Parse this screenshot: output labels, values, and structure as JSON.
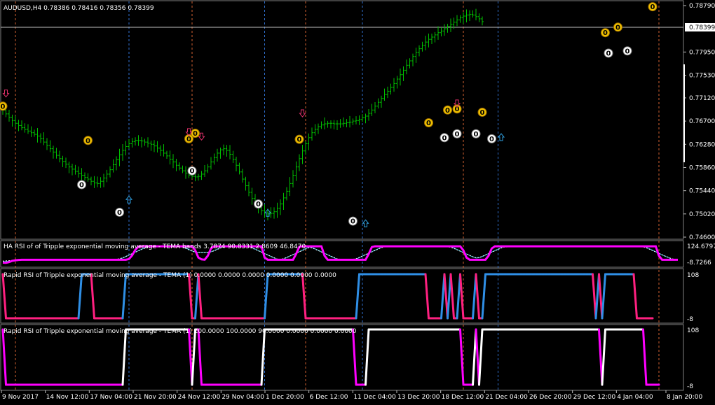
{
  "header": {
    "symbol_info": "AUDUSD,H4  0.78386 0.78416 0.78356 0.78399"
  },
  "colors": {
    "background": "#000000",
    "candles": "#00c000",
    "grid": "#808080",
    "price_line": "#c0c0c0",
    "vline_red": "#d06030",
    "vline_blue": "#3070d0",
    "pink": "#ff2080",
    "magenta": "#ff00ff",
    "blue": "#2f8fe6",
    "white": "#ffffff",
    "cyan": "#33c0e0",
    "yellow_marker": "#f0c000",
    "arrow_down": "#e0306a",
    "arrow_up": "#30a0e0"
  },
  "price_axis": {
    "labels": [
      "0.78790",
      "0.78399",
      "0.77950",
      "0.77530",
      "0.77120",
      "0.76700",
      "0.76280",
      "0.75860",
      "0.75440",
      "0.75020",
      "0.74600"
    ],
    "current": "0.78399"
  },
  "time_axis": {
    "labels": [
      "9 Nov 2017",
      "14 Nov 12:00",
      "17 Nov 04:00",
      "21 Nov 20:00",
      "24 Nov 12:00",
      "29 Nov 04:00",
      "1 Dec 20:00",
      "6 Dec 12:00",
      "11 Dec 04:00",
      "13 Dec 20:00",
      "18 Dec 12:00",
      "21 Dec 04:00",
      "26 Dec 20:00",
      "29 Dec 12:00",
      "4 Jan 04:00",
      "8 Jan 20:00"
    ]
  },
  "main_chart": {
    "marker_label": "0",
    "close_prices": [
      0.769,
      0.7683,
      0.7677,
      0.7671,
      0.7666,
      0.7662,
      0.7658,
      0.7655,
      0.7652,
      0.7649,
      0.7646,
      0.7643,
      0.7638,
      0.7632,
      0.7626,
      0.762,
      0.7614,
      0.7608,
      0.7602,
      0.7597,
      0.7592,
      0.7587,
      0.7583,
      0.7579,
      0.7575,
      0.7572,
      0.7568,
      0.7565,
      0.7561,
      0.7558,
      0.7557,
      0.7561,
      0.7567,
      0.7574,
      0.7582,
      0.7591,
      0.76,
      0.7609,
      0.7617,
      0.7624,
      0.7629,
      0.7633,
      0.7635,
      0.7635,
      0.7634,
      0.7632,
      0.763,
      0.7628,
      0.7625,
      0.7621,
      0.7617,
      0.7612,
      0.7607,
      0.7601,
      0.7596,
      0.759,
      0.7585,
      0.758,
      0.7576,
      0.7572,
      0.757,
      0.7569,
      0.757,
      0.7574,
      0.758,
      0.7587,
      0.7596,
      0.7604,
      0.7612,
      0.7618,
      0.762,
      0.7617,
      0.761,
      0.7601,
      0.759,
      0.7578,
      0.7565,
      0.7553,
      0.7541,
      0.753,
      0.7521,
      0.7514,
      0.7508,
      0.7504,
      0.7502,
      0.7503,
      0.7506,
      0.7512,
      0.752,
      0.7531,
      0.7543,
      0.7557,
      0.7572,
      0.7587,
      0.7602,
      0.7616,
      0.7629,
      0.764,
      0.7649,
      0.7655,
      0.766,
      0.7663,
      0.7665,
      0.7666,
      0.7666,
      0.7665,
      0.7665,
      0.7665,
      0.7666,
      0.7667,
      0.7668,
      0.767,
      0.7671,
      0.7673,
      0.7676,
      0.7679,
      0.7684,
      0.769,
      0.7697,
      0.7704,
      0.7711,
      0.7718,
      0.7724,
      0.7731,
      0.7738,
      0.7746,
      0.7754,
      0.7762,
      0.7771,
      0.7779,
      0.7787,
      0.7794,
      0.7801,
      0.7807,
      0.7813,
      0.7818,
      0.7822,
      0.7826,
      0.783,
      0.7833,
      0.7837,
      0.7841,
      0.7845,
      0.7849,
      0.7853,
      0.7857,
      0.786,
      0.7862,
      0.7863,
      0.7862,
      0.7859,
      0.7855,
      0.785
    ],
    "yellow_markers": [
      [
        0,
        0.7697
      ],
      [
        27,
        0.7635
      ],
      [
        59,
        0.7638
      ],
      [
        61,
        0.7648
      ],
      [
        94,
        0.7637
      ],
      [
        135,
        0.7667
      ],
      [
        141,
        0.769
      ],
      [
        144,
        0.7692
      ],
      [
        152,
        0.7686
      ],
      [
        191,
        0.783
      ],
      [
        195,
        0.784
      ],
      [
        206,
        0.7877
      ]
    ],
    "white_markers": [
      [
        25,
        0.7555
      ],
      [
        37,
        0.7505
      ],
      [
        60,
        0.758
      ],
      [
        81,
        0.752
      ],
      [
        111,
        0.7489
      ],
      [
        140,
        0.764
      ],
      [
        144,
        0.7647
      ],
      [
        150,
        0.7647
      ],
      [
        155,
        0.7638
      ],
      [
        192,
        0.7793
      ],
      [
        198,
        0.7797
      ]
    ],
    "down_arrows": [
      [
        1,
        0.772
      ],
      [
        59,
        0.765
      ],
      [
        63,
        0.7642
      ],
      [
        95,
        0.7684
      ],
      [
        144,
        0.7702
      ]
    ],
    "up_arrows": [
      [
        40,
        0.7528
      ],
      [
        84,
        0.7504
      ],
      [
        115,
        0.7485
      ],
      [
        158,
        0.7641
      ]
    ]
  },
  "panel1": {
    "title": "HA RSI of of Tripple exponential moving average - TEMA bands 3.7874 90.8331 2.8609 46.8470",
    "max_label": "124.6797",
    "min_label": "-8.7266"
  },
  "panel2": {
    "title": "Rapid RSI of Tripple exponential moving average - TEMA (1) 0.0000 0.0000 0.0000 0.0000 0.0000 0.0000",
    "max_label": "108",
    "min_label": "-8"
  },
  "panel3": {
    "title": "Rapid RSI of Tripple exponential moving average - TEMA (1) 100.0000 100.0000 90.0000 0.0000 0.0000 0.0000",
    "max_label": "108",
    "min_label": "-8"
  },
  "vlines": [
    {
      "x_idx": 4,
      "color": "red"
    },
    {
      "x_idx": 40,
      "color": "blue"
    },
    {
      "x_idx": 60,
      "color": "red"
    },
    {
      "x_idx": 83,
      "color": "blue"
    },
    {
      "x_idx": 96,
      "color": "red"
    },
    {
      "x_idx": 114,
      "color": "blue"
    },
    {
      "x_idx": 146,
      "color": "red"
    },
    {
      "x_idx": 157,
      "color": "blue"
    },
    {
      "x_idx": 208,
      "color": "red"
    }
  ],
  "panel1_series": [
    2,
    1,
    5,
    12,
    15,
    17,
    18,
    18,
    18,
    18,
    18,
    18,
    18,
    18,
    18,
    18,
    18,
    18,
    18,
    18,
    18,
    18,
    18,
    18,
    18,
    18,
    18,
    18,
    18,
    18,
    18,
    18,
    18,
    18,
    18,
    18,
    18,
    18,
    18,
    18,
    22,
    42,
    72,
    90,
    92,
    92,
    92,
    92,
    92,
    92,
    92,
    92,
    92,
    92,
    92,
    92,
    92,
    92,
    92,
    92,
    91,
    70,
    30,
    20,
    18,
    40,
    80,
    92,
    92,
    92,
    92,
    92,
    92,
    92,
    92,
    92,
    92,
    92,
    92,
    92,
    92,
    92,
    92,
    30,
    18,
    18,
    18,
    18,
    18,
    18,
    18,
    18,
    18,
    50,
    90,
    92,
    92,
    92,
    92,
    92,
    92,
    92,
    40,
    18,
    18,
    18,
    18,
    18,
    18,
    18,
    18,
    18,
    18,
    18,
    18,
    18,
    50,
    88,
    92,
    92,
    92,
    92,
    92,
    92,
    92,
    92,
    92,
    92,
    92,
    92,
    92,
    92,
    92,
    92,
    92,
    92,
    92,
    92,
    92,
    92,
    92,
    92,
    92,
    92,
    92,
    92,
    70,
    30,
    18,
    18,
    18,
    18,
    18,
    18,
    40,
    80,
    92,
    92,
    92,
    92,
    92,
    92,
    92,
    92,
    92,
    92,
    92,
    92,
    92,
    92,
    92,
    92,
    92,
    92,
    92,
    92,
    92,
    92,
    92,
    92,
    92,
    92,
    92,
    92,
    92,
    92,
    92,
    92,
    92,
    92,
    92,
    92,
    92,
    92,
    92,
    92,
    92,
    92,
    92,
    92,
    92,
    92,
    92,
    92,
    92,
    92,
    92,
    92,
    40,
    18,
    18,
    18,
    18,
    18,
    18
  ],
  "panel2_series": [
    100,
    0,
    0,
    0,
    0,
    0,
    0,
    0,
    0,
    0,
    0,
    0,
    0,
    0,
    0,
    0,
    0,
    0,
    0,
    0,
    0,
    0,
    0,
    0,
    0,
    100,
    100,
    100,
    100,
    0,
    0,
    0,
    0,
    0,
    0,
    0,
    0,
    0,
    0,
    100,
    100,
    100,
    100,
    100,
    100,
    100,
    100,
    100,
    100,
    100,
    100,
    100,
    100,
    100,
    100,
    100,
    100,
    100,
    100,
    100,
    0,
    0,
    100,
    0,
    0,
    0,
    0,
    0,
    0,
    0,
    0,
    0,
    0,
    0,
    0,
    0,
    0,
    0,
    0,
    0,
    0,
    0,
    0,
    0,
    100,
    100,
    100,
    100,
    100,
    100,
    100,
    100,
    100,
    100,
    100,
    100,
    0,
    0,
    0,
    0,
    0,
    0,
    0,
    0,
    0,
    0,
    0,
    0,
    0,
    0,
    0,
    0,
    0,
    100,
    100,
    100,
    100,
    100,
    100,
    100,
    100,
    100,
    100,
    100,
    100,
    100,
    100,
    100,
    100,
    100,
    100,
    100,
    100,
    100,
    100,
    0,
    0,
    0,
    0,
    0,
    100,
    0,
    100,
    0,
    0,
    100,
    0,
    0,
    0,
    0,
    100,
    0,
    0,
    100,
    100,
    100,
    100,
    100,
    100,
    100,
    100,
    100,
    100,
    100,
    100,
    100,
    100,
    100,
    100,
    100,
    100,
    100,
    100,
    100,
    100,
    100,
    100,
    100,
    100,
    100,
    100,
    100,
    100,
    100,
    100,
    100,
    100,
    100,
    0,
    100,
    0,
    100,
    100,
    100,
    100,
    100,
    100,
    100,
    100,
    100,
    100,
    0,
    0,
    0,
    0,
    0,
    0
  ],
  "panel3_series": [
    100,
    0,
    0,
    0,
    0,
    0,
    0,
    0,
    0,
    0,
    0,
    0,
    0,
    0,
    0,
    0,
    0,
    0,
    0,
    0,
    0,
    0,
    0,
    0,
    0,
    0,
    0,
    0,
    0,
    0,
    0,
    0,
    0,
    0,
    0,
    0,
    0,
    0,
    0,
    100,
    100,
    100,
    100,
    100,
    100,
    100,
    100,
    100,
    100,
    100,
    100,
    100,
    100,
    100,
    100,
    100,
    100,
    100,
    100,
    100,
    0,
    100,
    100,
    0,
    0,
    0,
    0,
    0,
    0,
    0,
    0,
    0,
    0,
    0,
    0,
    0,
    0,
    0,
    0,
    0,
    0,
    0,
    0,
    100,
    100,
    100,
    100,
    100,
    100,
    100,
    100,
    100,
    100,
    100,
    100,
    100,
    100,
    100,
    100,
    100,
    100,
    100,
    100,
    100,
    100,
    100,
    100,
    100,
    100,
    100,
    100,
    100,
    0,
    0,
    0,
    0,
    100,
    100,
    100,
    100,
    100,
    100,
    100,
    100,
    100,
    100,
    100,
    100,
    100,
    100,
    100,
    100,
    100,
    100,
    100,
    100,
    100,
    100,
    100,
    100,
    100,
    100,
    100,
    100,
    100,
    100,
    0,
    0,
    0,
    0,
    100,
    0,
    100,
    100,
    100,
    100,
    100,
    100,
    100,
    100,
    100,
    100,
    100,
    100,
    100,
    100,
    100,
    100,
    100,
    100,
    100,
    100,
    100,
    100,
    100,
    100,
    100,
    100,
    100,
    100,
    100,
    100,
    100,
    100,
    100,
    100,
    100,
    100,
    100,
    100,
    0,
    100,
    100,
    100,
    100,
    100,
    100,
    100,
    100,
    100,
    100,
    100,
    100,
    100,
    0,
    0,
    0,
    0,
    0
  ]
}
